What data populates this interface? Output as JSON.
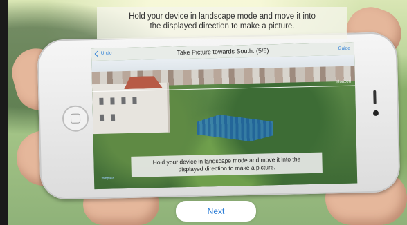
{
  "overlay": {
    "instruction_lines": [
      "Hold your device in landscape mode and move it into",
      "the displayed direction to make a picture."
    ]
  },
  "screen": {
    "back_label": "Undo",
    "title": "Take Picture towards South. (5/6)",
    "guide_label": "Guide",
    "horizon_label": "Horizon",
    "message_lines": [
      "Hold your device in landscape mode and move it into the",
      "displayed direction to make a picture."
    ],
    "bottom_left_label": "Compass"
  },
  "next_button": {
    "label": "Next"
  },
  "colors": {
    "accent": "#2a7cd6",
    "target_box": "#1e64aa"
  }
}
